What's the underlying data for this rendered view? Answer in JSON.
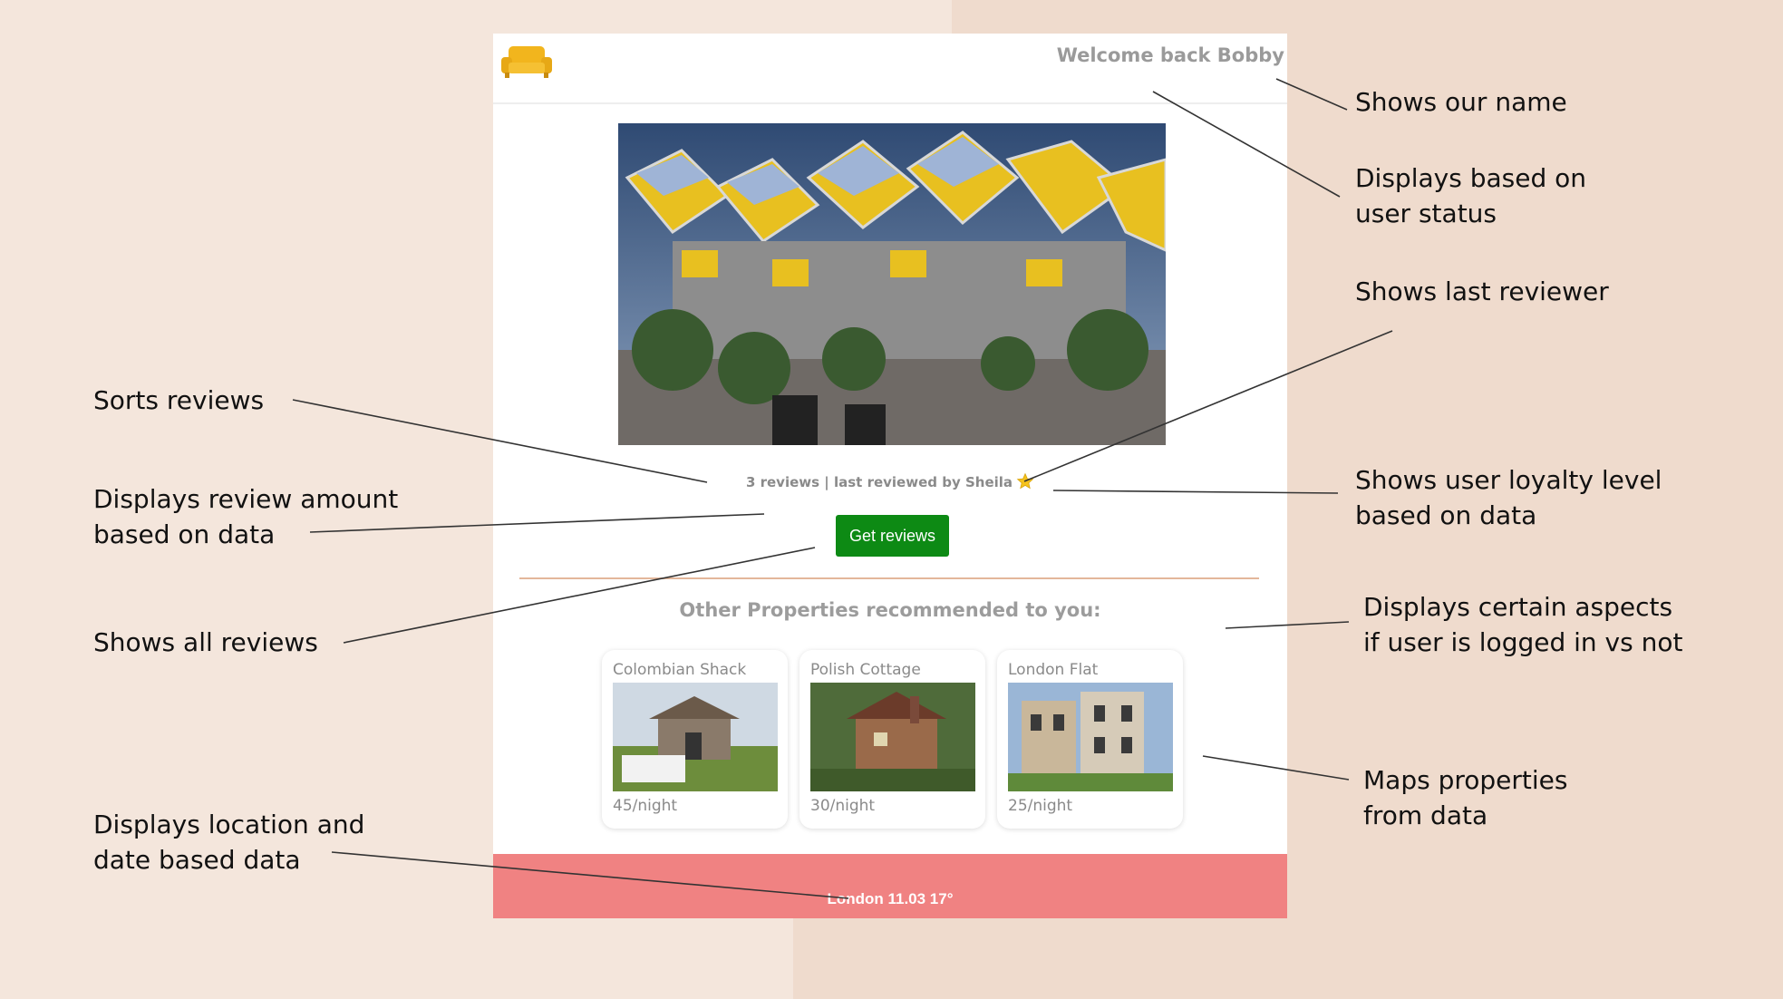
{
  "header": {
    "welcome": "Welcome back Bobby"
  },
  "reviews": {
    "summary": "3 reviews | last reviewed by Sheila",
    "button_label": "Get reviews"
  },
  "recommended": {
    "heading": "Other Properties recommended to you:",
    "properties": [
      {
        "name": "Colombian Shack",
        "price": "45/night"
      },
      {
        "name": "Polish Cottage",
        "price": "30/night"
      },
      {
        "name": "London Flat",
        "price": "25/night"
      }
    ]
  },
  "footer": {
    "text": "London 11.03 17°"
  },
  "annotations": {
    "shows_our_name": [
      "Shows our name"
    ],
    "user_status": [
      "Displays based on",
      "user status"
    ],
    "last_reviewer": [
      "Shows last reviewer"
    ],
    "loyalty": [
      "Shows user loyalty level",
      "based on data"
    ],
    "logged_in": [
      "Displays certain aspects",
      "if user is logged in vs not"
    ],
    "maps_properties": [
      "Maps properties",
      "from data"
    ],
    "sorts": [
      "Sorts reviews"
    ],
    "review_amount": [
      "Displays review amount",
      "based on data"
    ],
    "all_reviews": [
      "Shows all reviews"
    ],
    "location_date": [
      "Displays location and",
      "date based data"
    ]
  },
  "colors": {
    "background": "#f4e6dc",
    "accent_green": "#0d8a14",
    "footer_pink": "#f08282",
    "divider": "#e3b79b"
  },
  "icons": [
    "sofa-logo-icon",
    "star-icon"
  ]
}
